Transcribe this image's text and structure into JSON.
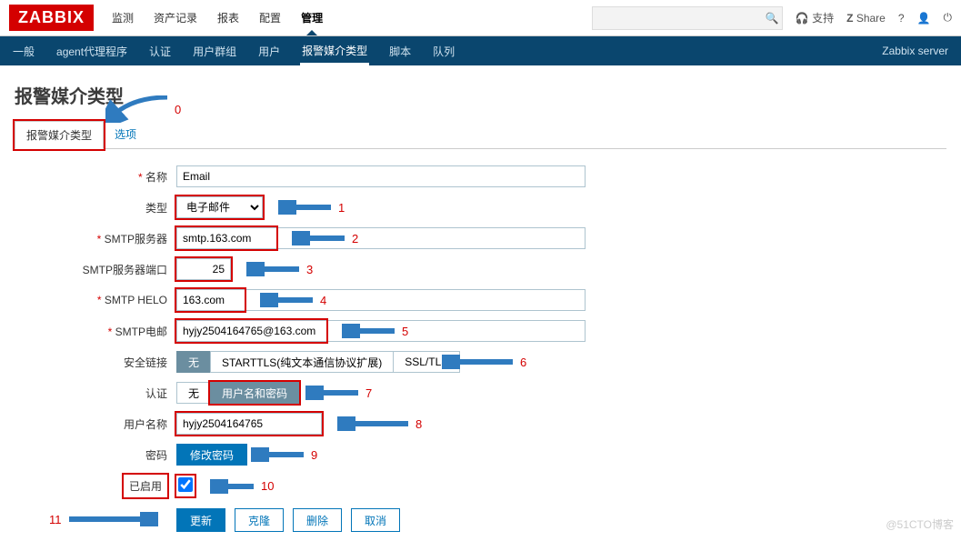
{
  "header": {
    "logo": "ZABBIX",
    "nav": [
      "监测",
      "资产记录",
      "报表",
      "配置",
      "管理"
    ],
    "nav_active": 4,
    "support": "支持",
    "share": "Share",
    "search_placeholder": ""
  },
  "subnav": {
    "items": [
      "一般",
      "agent代理程序",
      "认证",
      "用户群组",
      "用户",
      "报警媒介类型",
      "脚本",
      "队列"
    ],
    "active": 5,
    "server": "Zabbix server"
  },
  "page": {
    "title": "报警媒介类型",
    "tabs": [
      "报警媒介类型",
      "选项"
    ],
    "tab_active": 0
  },
  "form": {
    "name_label": "名称",
    "name_value": "Email",
    "type_label": "类型",
    "type_value": "电子邮件",
    "smtp_server_label": "SMTP服务器",
    "smtp_server_value": "smtp.163.com",
    "smtp_port_label": "SMTP服务器端口",
    "smtp_port_value": "25",
    "smtp_helo_label": "SMTP HELO",
    "smtp_helo_value": "163.com",
    "smtp_email_label": "SMTP电邮",
    "smtp_email_value": "hyjy2504164765@163.com",
    "secure_label": "安全链接",
    "secure_options": [
      "无",
      "STARTTLS(纯文本通信协议扩展)",
      "SSL/TLS"
    ],
    "secure_active": 0,
    "auth_label": "认证",
    "auth_options": [
      "无",
      "用户名和密码"
    ],
    "auth_active": 1,
    "user_label": "用户名称",
    "user_value": "hyjy2504164765",
    "pass_label": "密码",
    "pass_btn": "修改密码",
    "enabled_label": "已启用",
    "enabled": true,
    "btn_update": "更新",
    "btn_clone": "克隆",
    "btn_delete": "删除",
    "btn_cancel": "取消"
  },
  "annotations": {
    "a0": "0",
    "a1": "1",
    "a2": "2",
    "a3": "3",
    "a4": "4",
    "a5": "5",
    "a6": "6",
    "a7": "7",
    "a8": "8",
    "a9": "9",
    "a10": "10",
    "a11": "11"
  },
  "watermark": "@51CTO博客"
}
